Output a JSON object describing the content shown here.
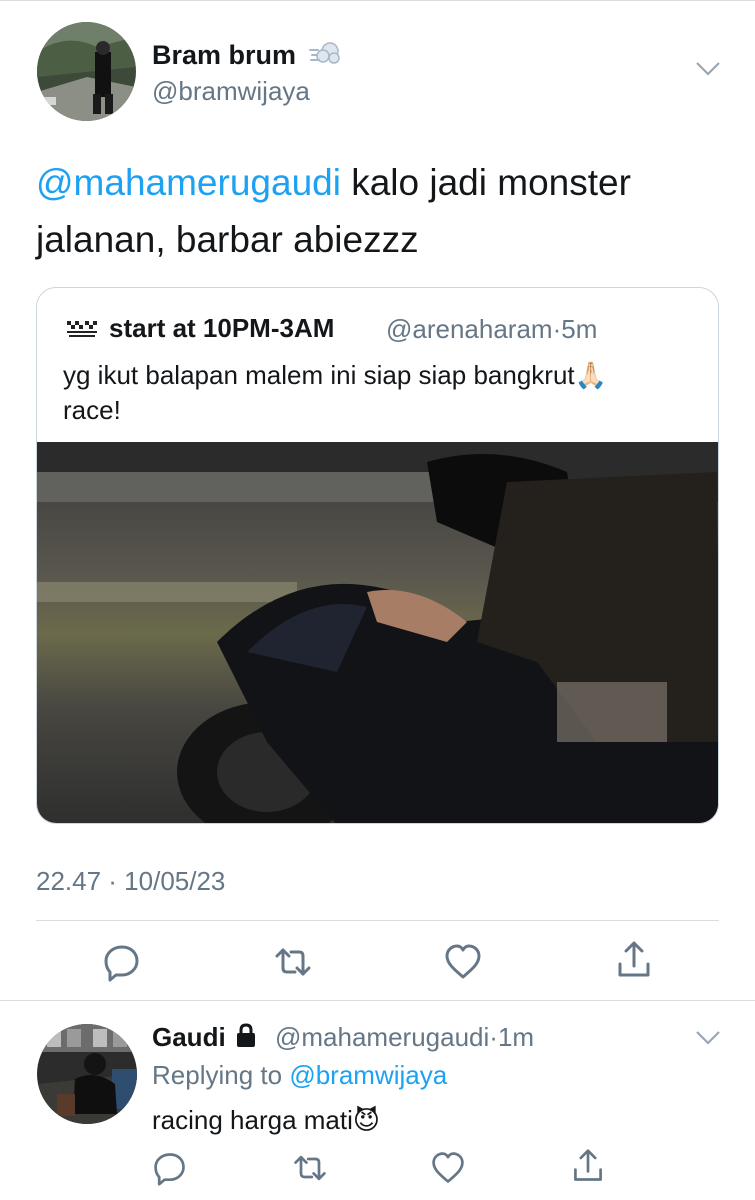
{
  "tweet": {
    "author_name": "Bram brum",
    "author_handle": "@bramwijaya",
    "author_emoji_icon": "dash-icon",
    "mention": "@mahamerugaudi",
    "text": " kalo jadi monster jalanan, barbar abiezzz",
    "timestamp": "22.47 · 10/05/23"
  },
  "quoted": {
    "icon": "checkered-flags-icon",
    "name": "start at 10PM-3AM",
    "handle": "@arenaharam",
    "dot": "·",
    "time": "5m",
    "text": "yg ikut balapan malem ini siap siap bangkrut",
    "emoji": "🙏🏻",
    "text2": "race!",
    "image": "motorcycle-rider-night-photo"
  },
  "actions": [
    "reply-icon",
    "retweet-icon",
    "like-icon",
    "share-icon"
  ],
  "reply": {
    "name": "Gaudi",
    "lock_icon": "lock-icon",
    "handle": "@mahamerugaudi",
    "time_sep": "·",
    "time": "1m",
    "replying_prefix": "Replying to ",
    "replying_to": "@bramwijaya",
    "text": "racing harga mati",
    "emoji": "😈"
  },
  "colors": {
    "accent": "#1da1f2",
    "secondary_text": "#657786",
    "border": "#ccd6dd"
  }
}
